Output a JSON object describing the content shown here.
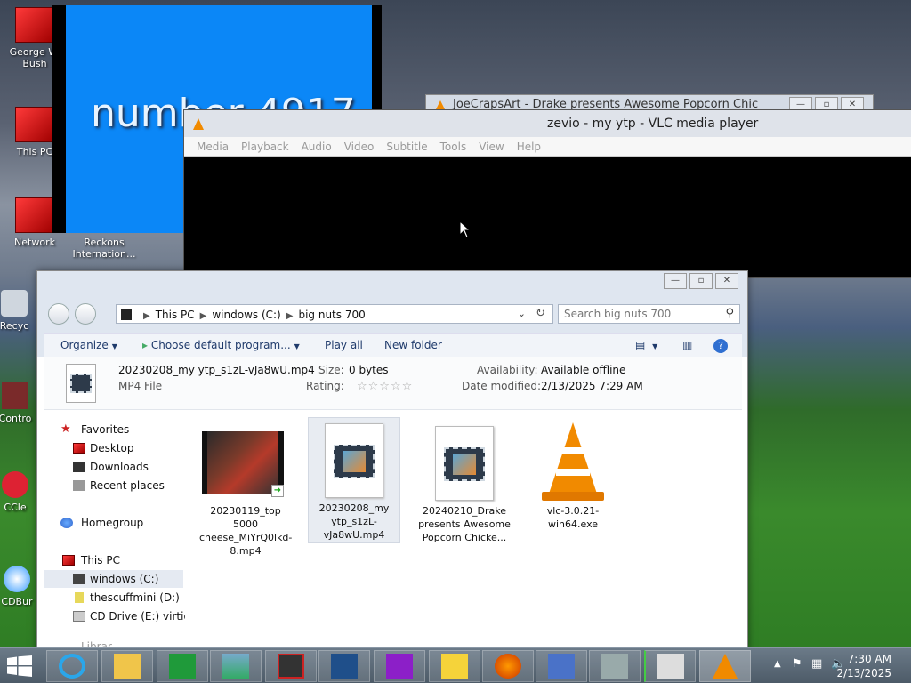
{
  "desktop": {
    "icons": [
      {
        "label": "George W. Bush"
      },
      {
        "label": "This PC"
      },
      {
        "label": "Network"
      },
      {
        "label": "Reckons Internation..."
      },
      {
        "label": "Recyc"
      },
      {
        "label": "Contro"
      },
      {
        "label": "CCle"
      },
      {
        "label": "CDBur"
      }
    ]
  },
  "blue_window": {
    "text": "number 4917"
  },
  "bg_window": {
    "title": "JoeCrapsArt - Drake presents Awesome Popcorn Chic"
  },
  "vlc": {
    "title": "zevio - my ytp - VLC media player",
    "menu": [
      "Media",
      "Playback",
      "Audio",
      "Video",
      "Subtitle",
      "Tools",
      "View",
      "Help"
    ]
  },
  "explorer": {
    "breadcrumbs": [
      "This PC",
      "windows (C:)",
      "big nuts 700"
    ],
    "search_placeholder": "Search big nuts 700",
    "commands": {
      "organize": "Organize",
      "choose_default": "Choose default program...",
      "play_all": "Play all",
      "new_folder": "New folder"
    },
    "details": {
      "filename": "20230208_my ytp_s1zL-vJa8wU.mp4",
      "filetype": "MP4 File",
      "size_label": "Size:",
      "size_value": "0 bytes",
      "rating_label": "Rating:",
      "rating_stars": "☆☆☆☆☆",
      "availability_label": "Availability:",
      "availability_value": "Available offline",
      "date_label": "Date modified:",
      "date_value": "2/13/2025 7:29 AM"
    },
    "nav": {
      "favorites": "Favorites",
      "desktop": "Desktop",
      "downloads": "Downloads",
      "recent": "Recent places",
      "homegroup": "Homegroup",
      "thispc": "This PC",
      "windows": "windows (C:)",
      "thescuff": "thescuffmini (D:)",
      "cddrive": "CD Drive (E:) virtio-v",
      "libraries": "Librar"
    },
    "files": [
      {
        "name": "20230119_top 5000 cheese_MiYrQ0lkd-8.mp4"
      },
      {
        "name": "20230208_my ytp_s1zL-vJa8wU.mp4"
      },
      {
        "name": "20240210_Drake presents Awesome Popcorn Chicke..."
      },
      {
        "name": "vlc-3.0.21-win64.exe"
      }
    ]
  },
  "taskbar": {
    "time": "7:30 AM",
    "date": "2/13/2025"
  },
  "colors": {
    "accent": "#1f3a6b",
    "vlc_orange": "#f18a00",
    "blue_screen": "#0b87f7"
  }
}
